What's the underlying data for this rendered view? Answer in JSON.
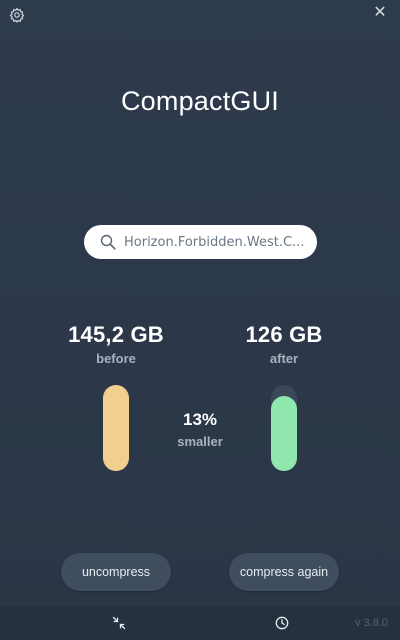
{
  "app": {
    "title": "CompactGUI"
  },
  "search": {
    "value": "Horizon.Forbidden.West.C..."
  },
  "stats": {
    "before": {
      "size": "145,2 GB",
      "label": "before",
      "fill_fraction": 1.0
    },
    "after": {
      "size": "126 GB",
      "label": "after",
      "fill_fraction": 0.87
    },
    "change": {
      "percent": "13%",
      "label": "smaller"
    }
  },
  "buttons": {
    "uncompress": "uncompress",
    "compress_again": "compress again"
  },
  "footer": {
    "version": "v 3.8.0"
  },
  "icons": {
    "settings": "gear-icon",
    "close": "close-icon",
    "search": "search-icon",
    "compress": "compress-arrows-icon",
    "history": "clock-icon"
  },
  "colors": {
    "background": "#2e3b4d",
    "before_bar": "#f0cf8f",
    "after_bar": "#8fe7ad",
    "button": "#3f4d5e",
    "footer": "#263140"
  }
}
